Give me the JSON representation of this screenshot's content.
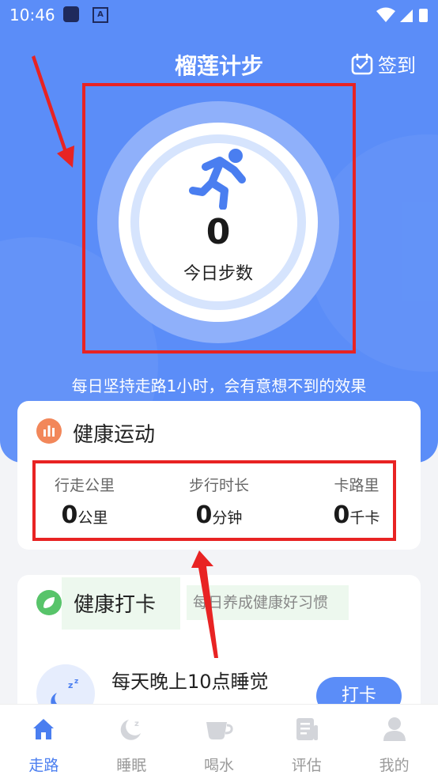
{
  "status_bar": {
    "time": "10:46"
  },
  "header": {
    "title": "榴莲计步",
    "signin_label": "签到"
  },
  "steps": {
    "value": "0",
    "label": "今日步数"
  },
  "motto": "每日坚持走路1小时，会有意想不到的效果",
  "health_sport": {
    "title": "健康运动",
    "stats": [
      {
        "label": "行走公里",
        "value": "0",
        "unit": "公里"
      },
      {
        "label": "步行时长",
        "value": "0",
        "unit": "分钟"
      },
      {
        "label": "卡路里",
        "value": "0",
        "unit": "千卡"
      }
    ]
  },
  "health_checkin": {
    "title": "健康打卡",
    "subtitle": "每日养成健康好习惯",
    "task": {
      "title": "每天晚上10点睡觉",
      "button": "打卡"
    }
  },
  "tabs": [
    {
      "label": "走路",
      "active": true
    },
    {
      "label": "睡眠",
      "active": false
    },
    {
      "label": "喝水",
      "active": false
    },
    {
      "label": "评估",
      "active": false
    },
    {
      "label": "我的",
      "active": false
    }
  ],
  "colors": {
    "primary": "#5b8df8",
    "highlight": "#e82323",
    "accent_orange": "#f2875a",
    "accent_green": "#58c46a"
  }
}
